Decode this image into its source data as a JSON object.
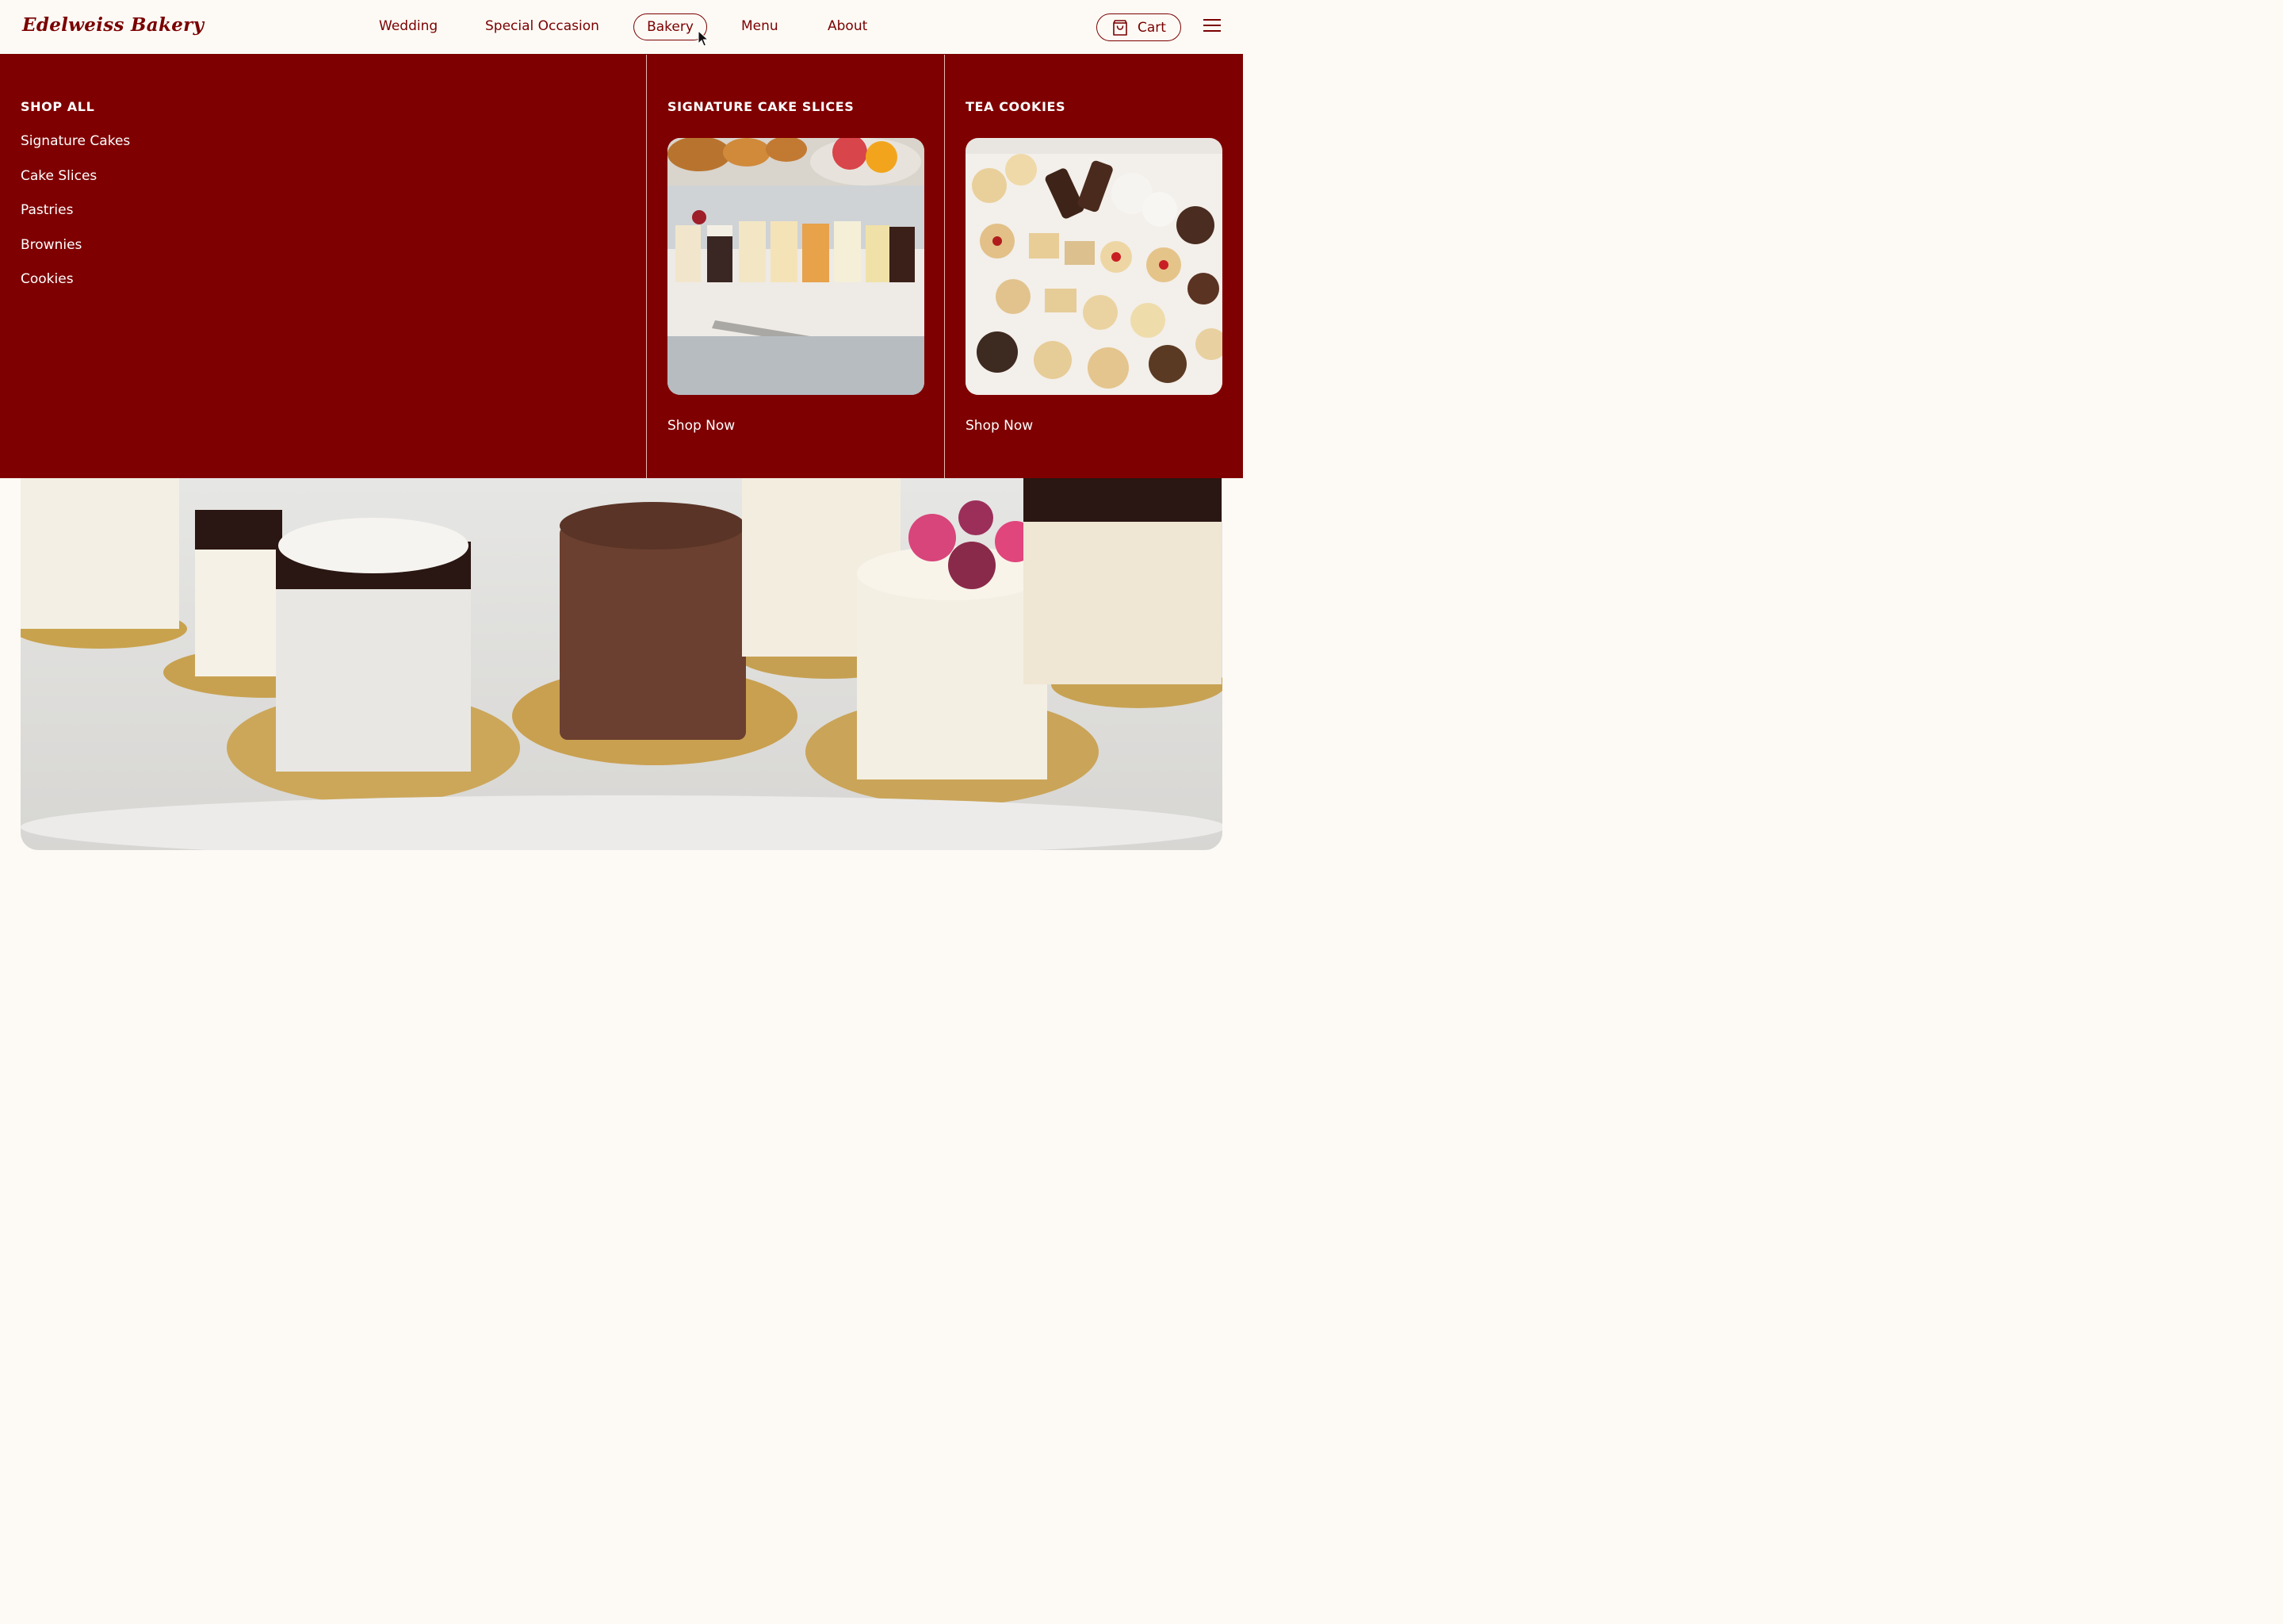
{
  "header": {
    "logo": "Edelweiss Bakery",
    "nav": {
      "wedding": "Wedding",
      "special_occasion": "Special Occasion",
      "bakery": "Bakery",
      "menu": "Menu",
      "about": "About"
    },
    "cart_label": "Cart"
  },
  "mega_menu": {
    "shop_all": {
      "heading": "SHOP ALL",
      "links": [
        "Signature Cakes",
        "Cake Slices",
        "Pastries",
        "Brownies",
        "Cookies"
      ]
    },
    "features": [
      {
        "heading": "SIGNATURE CAKE SLICES",
        "cta": "Shop Now",
        "image": "cake-slices-photo"
      },
      {
        "heading": "TEA COOKIES",
        "cta": "Shop Now",
        "image": "tea-cookies-photo"
      }
    ]
  },
  "hero": {
    "image": "assorted-cakes-photo"
  },
  "colors": {
    "brand": "#7a0000",
    "menu_background": "#7f0000",
    "page_background": "#fdfaf5",
    "menu_text": "#ffffff"
  }
}
